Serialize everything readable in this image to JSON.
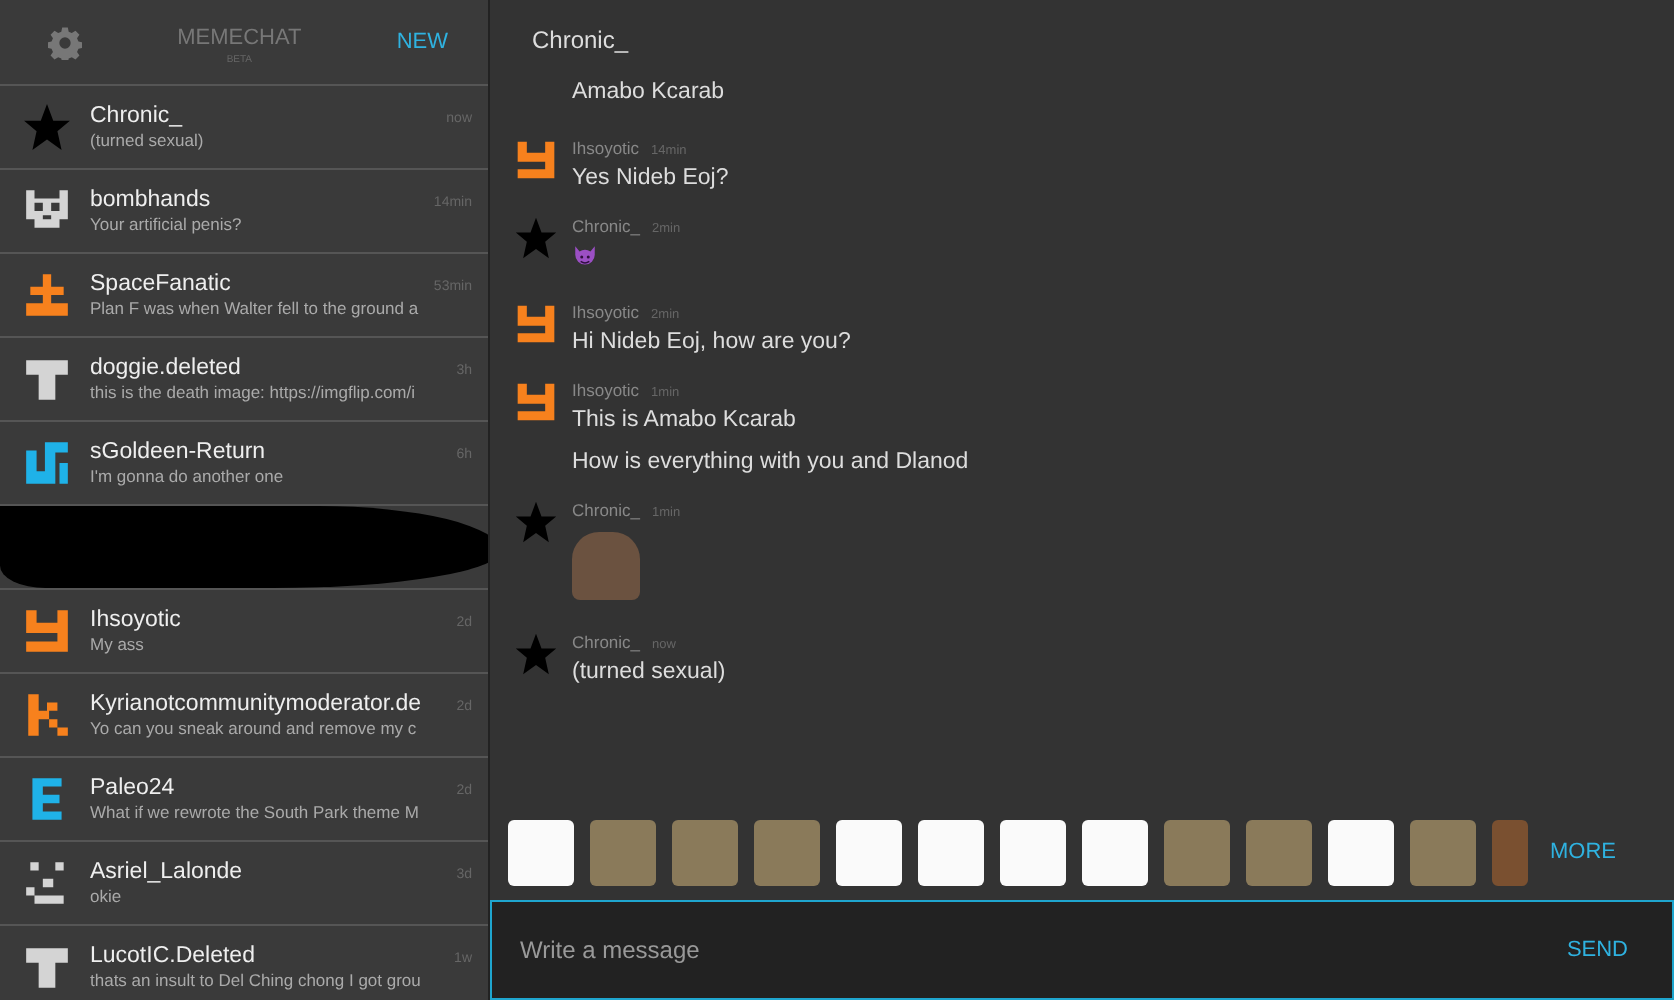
{
  "sidebar": {
    "title": "MEMECHAT",
    "subtitle": "BETA",
    "new_button": "NEW",
    "items": [
      {
        "kind": "star",
        "color": "#000000",
        "name": "Chronic_",
        "preview": "(turned sexual)",
        "time": "now"
      },
      {
        "kind": "invader",
        "color": "#d4d4d4",
        "name": "bombhands",
        "preview": "Your artificial penis?",
        "time": "14min"
      },
      {
        "kind": "cross",
        "color": "#f7811d",
        "name": "SpaceFanatic",
        "preview": "Plan F was when Walter fell to the ground a",
        "time": "53min"
      },
      {
        "kind": "shirt",
        "color": "#d4d4d4",
        "name": "doggie.deleted",
        "preview": "this is the death image: https://imgflip.com/i",
        "time": "3h"
      },
      {
        "kind": "hook",
        "color": "#1fb2e8",
        "name": "sGoldeen-Return",
        "preview": "I'm gonna do another one",
        "time": "6h"
      },
      {
        "kind": "redacted"
      },
      {
        "kind": "y",
        "color": "#f7811d",
        "name": "Ihsoyotic",
        "preview": "My ass",
        "time": "2d"
      },
      {
        "kind": "k",
        "color": "#f7811d",
        "name": "Kyrianotcommunitymoderator.de",
        "preview": "Yo can you sneak around and remove my c",
        "time": "2d"
      },
      {
        "kind": "e",
        "color": "#1fb2e8",
        "name": "Paleo24",
        "preview": "What if we rewrote the South Park theme M",
        "time": "2d"
      },
      {
        "kind": "face",
        "color": "#d4d4d4",
        "name": "Asriel_Lalonde",
        "preview": "okie",
        "time": "3d"
      },
      {
        "kind": "shirt",
        "color": "#d4d4d4",
        "name": "LucotIC.Deleted",
        "preview": "thats an insult to Del Ching chong I got grou",
        "time": "1w"
      }
    ]
  },
  "chat": {
    "title": "Chronic_",
    "messages": [
      {
        "kind": "hidden",
        "parts": [
          {
            "kind": "text",
            "text": "Amabo Kcarab"
          }
        ]
      },
      {
        "kind": "y",
        "color": "#f7811d",
        "sender": "Ihsoyotic",
        "time": "14min",
        "parts": [
          {
            "kind": "text",
            "text": "Yes Nideb Eoj?"
          }
        ]
      },
      {
        "kind": "star",
        "color": "#000000",
        "sender": "Chronic_",
        "time": "2min",
        "parts": [
          {
            "kind": "devil"
          }
        ]
      },
      {
        "kind": "y",
        "color": "#f7811d",
        "sender": "Ihsoyotic",
        "time": "2min",
        "parts": [
          {
            "kind": "text",
            "text": "Hi Nideb Eoj, how are you?"
          }
        ]
      },
      {
        "kind": "y",
        "color": "#f7811d",
        "sender": "Ihsoyotic",
        "time": "1min",
        "parts": [
          {
            "kind": "text",
            "text": "This is Amabo Kcarab"
          },
          {
            "kind": "text",
            "text": "How is everything with you and Dlanod"
          }
        ]
      },
      {
        "kind": "star",
        "color": "#000000",
        "sender": "Chronic_",
        "time": "1min",
        "parts": [
          {
            "kind": "photo"
          }
        ]
      },
      {
        "kind": "star",
        "color": "#000000",
        "sender": "Chronic_",
        "time": "now",
        "parts": [
          {
            "kind": "text",
            "text": "(turned sexual)"
          }
        ]
      }
    ]
  },
  "stickers": {
    "items": [
      {
        "kind": "drawing"
      },
      {
        "kind": "photo"
      },
      {
        "kind": "photo"
      },
      {
        "kind": "photo"
      },
      {
        "kind": "drawing"
      },
      {
        "kind": "drawing"
      },
      {
        "kind": "drawing"
      },
      {
        "kind": "drawing"
      },
      {
        "kind": "photo"
      },
      {
        "kind": "photo"
      },
      {
        "kind": "drawing"
      },
      {
        "kind": "photo"
      },
      {
        "kind": "partial"
      }
    ],
    "more": "MORE"
  },
  "composer": {
    "placeholder": "Write a message",
    "send": "SEND"
  }
}
